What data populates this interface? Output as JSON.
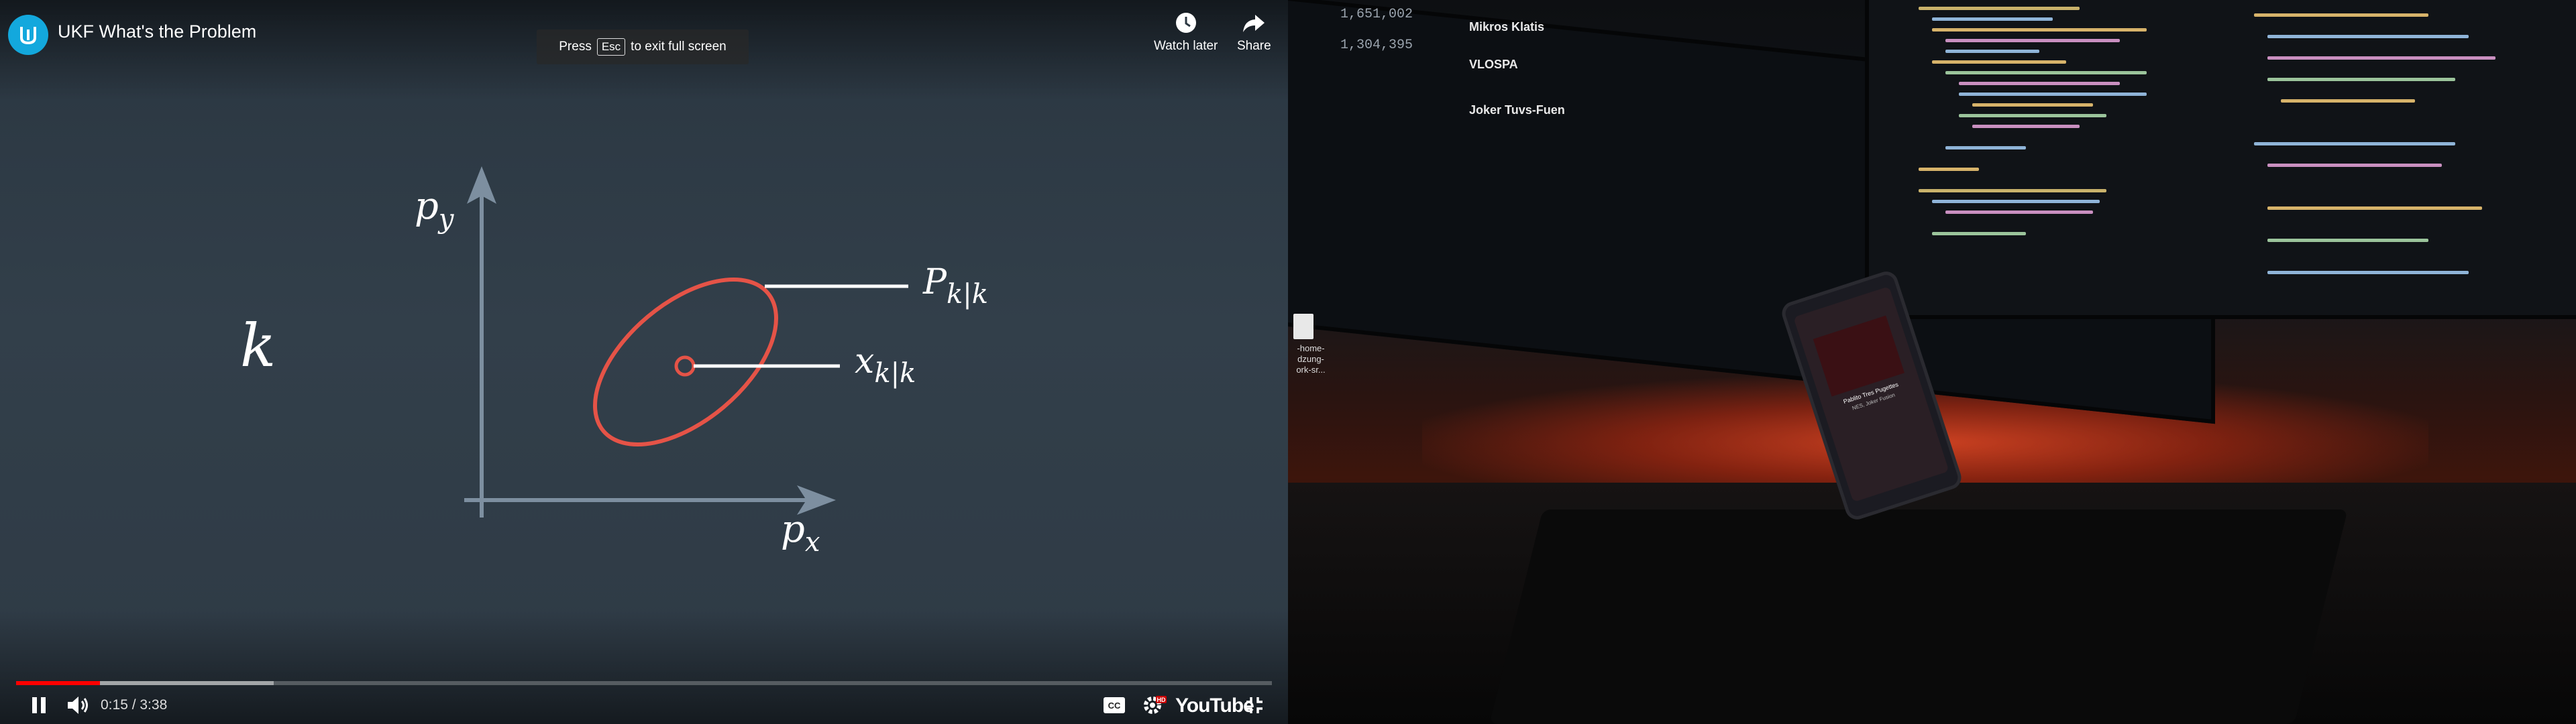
{
  "player": {
    "video_title": "UKF What's the Problem",
    "esc_prefix": "Press",
    "esc_key": "Esc",
    "esc_suffix": "to exit full screen",
    "watch_later_label": "Watch later",
    "share_label": "Share",
    "time_text": "0:15 / 3:38",
    "progress_played_fraction": 0.067,
    "progress_buffered_fraction": 0.205,
    "cc_label": "CC",
    "hd_badge": "HD",
    "youtube_logo_text": "YouTube",
    "icons": [
      "udacity-logo-icon",
      "clock-icon",
      "share-arrow-icon",
      "pause-icon",
      "volume-icon",
      "captions-icon",
      "settings-gear-icon",
      "exit-fullscreen-icon"
    ]
  },
  "diagram": {
    "big_label": "k",
    "y_axis_label_base": "p",
    "y_axis_label_sub": "y",
    "x_axis_label_base": "p",
    "x_axis_label_sub": "x",
    "covariance_label_base": "P",
    "covariance_label_sub": "k|k",
    "state_label_base": "x",
    "state_label_sub": "k|k",
    "ellipse_color": "#e55347",
    "axis_color": "#7d8fa0"
  },
  "wallpaper": {
    "monitor_numbers": [
      "1,651,002",
      "1,304,395"
    ],
    "monitor_names": [
      "Mikros Klatis",
      "VLOSPA",
      "Joker Tuvs-Fuen"
    ],
    "phone_song_title": "Pablito Tres Pugettes",
    "phone_artist": "NES, Joker Fusion",
    "desktop_file_label": "-home-dzung-ork-sr...",
    "code_color_accent": "#d7b36a"
  }
}
